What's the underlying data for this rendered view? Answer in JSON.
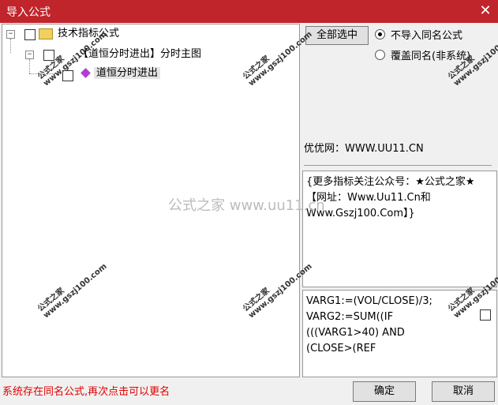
{
  "window": {
    "title": "导入公式",
    "close_glyph": "✕"
  },
  "tree": {
    "root_label": "技术指标公式",
    "child_label": "【道恒分时进出】分时主图",
    "leaf_label": "道恒分时进出"
  },
  "options": {
    "select_all": "全部选中",
    "radio_skip": "不导入同名公式",
    "radio_overwrite": "覆盖同名(非系统)"
  },
  "site": "优优网：WWW.UU11.CN",
  "description": "{更多指标关注公众号：★公式之家★【网址：Www.Uu11.Cn和Www.Gszj100.Com】}",
  "code": "VARG1:=(VOL/CLOSE)/3;\nVARG2:=SUM((IF\n(((VARG1>40) AND\n(CLOSE>(REF",
  "watermark": {
    "name": "公式之家",
    "url": "www.gszj100.com",
    "center": "公式之家 www.uu11.cn"
  },
  "status": "系统存在同名公式,再次点击可以更名",
  "buttons": {
    "ok": "确定",
    "cancel": "取消"
  }
}
